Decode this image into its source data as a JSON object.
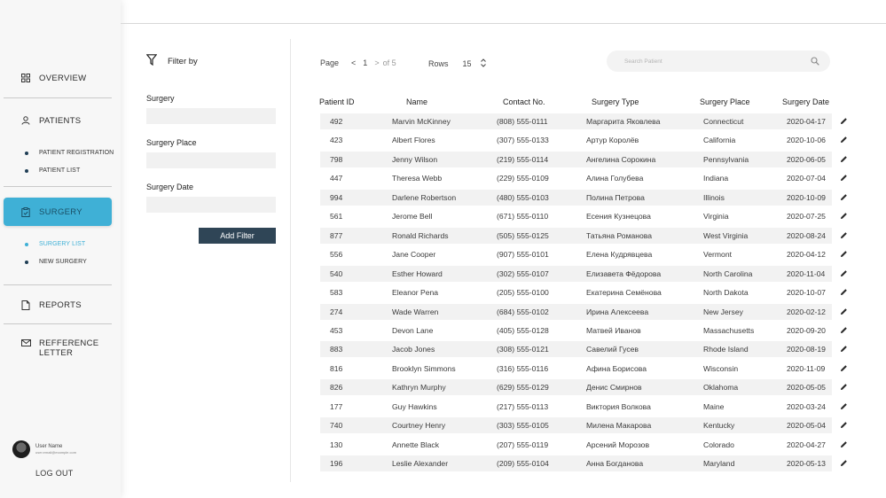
{
  "sidebar": {
    "items": [
      {
        "label": "OVERVIEW",
        "icon": "grid-icon"
      },
      {
        "label": "PATIENTS",
        "icon": "user-icon"
      },
      {
        "label": "SURGERY",
        "icon": "clipboard-icon"
      },
      {
        "label": "REPORTS",
        "icon": "document-icon"
      },
      {
        "label": "REFFERENCE LETTER",
        "icon": "mail-icon"
      }
    ],
    "patients_sub": [
      "PATIENT REGISTRATION",
      "PATIENT LIST"
    ],
    "surgery_sub": [
      "SURGERY LIST",
      "NEW SURGERY"
    ],
    "user_name": "User Name",
    "user_email": "user.email@example.com",
    "logout": "LOG OUT",
    "accent_color": "#3fb0d6"
  },
  "filter": {
    "title": "Filter by",
    "surgery_label": "Surgery",
    "place_label": "Surgery Place",
    "date_label": "Surgery Date",
    "add_button": "Add Filter"
  },
  "toolbar": {
    "page_label": "Page",
    "prev": "<",
    "current_page": "1",
    "next": ">",
    "of_pages": "of 5",
    "rows_label": "Rows",
    "rows_value": "15",
    "search_placeholder": "Search Patient"
  },
  "table": {
    "headers": [
      "Patient ID",
      "Name",
      "Contact No.",
      "Surgery Type",
      "Surgery Place",
      "Surgery Date"
    ],
    "rows": [
      [
        "492",
        "Marvin McKinney",
        "(808) 555-0111",
        "Маргарита Яковлева",
        "Connecticut",
        "2020-04-17"
      ],
      [
        "423",
        "Albert Flores",
        "(307) 555-0133",
        "Артур Королёв",
        "California",
        "2020-10-06"
      ],
      [
        "798",
        "Jenny Wilson",
        "(219) 555-0114",
        "Ангелина Сорокина",
        "Pennsylvania",
        "2020-06-05"
      ],
      [
        "447",
        "Theresa Webb",
        "(229) 555-0109",
        "Алина Голубева",
        "Indiana",
        "2020-07-04"
      ],
      [
        "994",
        "Darlene Robertson",
        "(480) 555-0103",
        "Полина Петрова",
        "Illinois",
        "2020-10-09"
      ],
      [
        "561",
        "Jerome Bell",
        "(671) 555-0110",
        "Есения Кузнецова",
        "Virginia",
        "2020-07-25"
      ],
      [
        "877",
        "Ronald Richards",
        "(505) 555-0125",
        "Татьяна Романова",
        "West Virginia",
        "2020-08-24"
      ],
      [
        "556",
        "Jane Cooper",
        "(907) 555-0101",
        "Елена Кудрявцева",
        "Vermont",
        "2020-04-12"
      ],
      [
        "540",
        "Esther Howard",
        "(302) 555-0107",
        "Елизавета Фёдорова",
        "North Carolina",
        "2020-11-04"
      ],
      [
        "583",
        "Eleanor Pena",
        "(205) 555-0100",
        "Екатерина Семёнова",
        "North Dakota",
        "2020-10-07"
      ],
      [
        "274",
        "Wade Warren",
        "(684) 555-0102",
        "Ирина Алексеева",
        "New Jersey",
        "2020-02-12"
      ],
      [
        "453",
        "Devon Lane",
        "(405) 555-0128",
        "Матвей Иванов",
        "Massachusetts",
        "2020-09-20"
      ],
      [
        "883",
        "Jacob Jones",
        "(308) 555-0121",
        "Савелий Гусев",
        "Rhode Island",
        "2020-08-19"
      ],
      [
        "816",
        "Brooklyn Simmons",
        "(316) 555-0116",
        "Афина Борисова",
        "Wisconsin",
        "2020-11-09"
      ],
      [
        "826",
        "Kathryn Murphy",
        "(629) 555-0129",
        "Денис Смирнов",
        "Oklahoma",
        "2020-05-05"
      ],
      [
        "177",
        "Guy Hawkins",
        "(217) 555-0113",
        "Виктория Волкова",
        "Maine",
        "2020-03-24"
      ],
      [
        "740",
        "Courtney Henry",
        "(303) 555-0105",
        "Милена Макарова",
        "Kentucky",
        "2020-05-04"
      ],
      [
        "130",
        "Annette Black",
        "(207) 555-0119",
        "Арсений Морозов",
        "Colorado",
        "2020-04-27"
      ],
      [
        "196",
        "Leslie Alexander",
        "(209) 555-0104",
        "Анна Богданова",
        "Maryland",
        "2020-05-13"
      ]
    ]
  }
}
